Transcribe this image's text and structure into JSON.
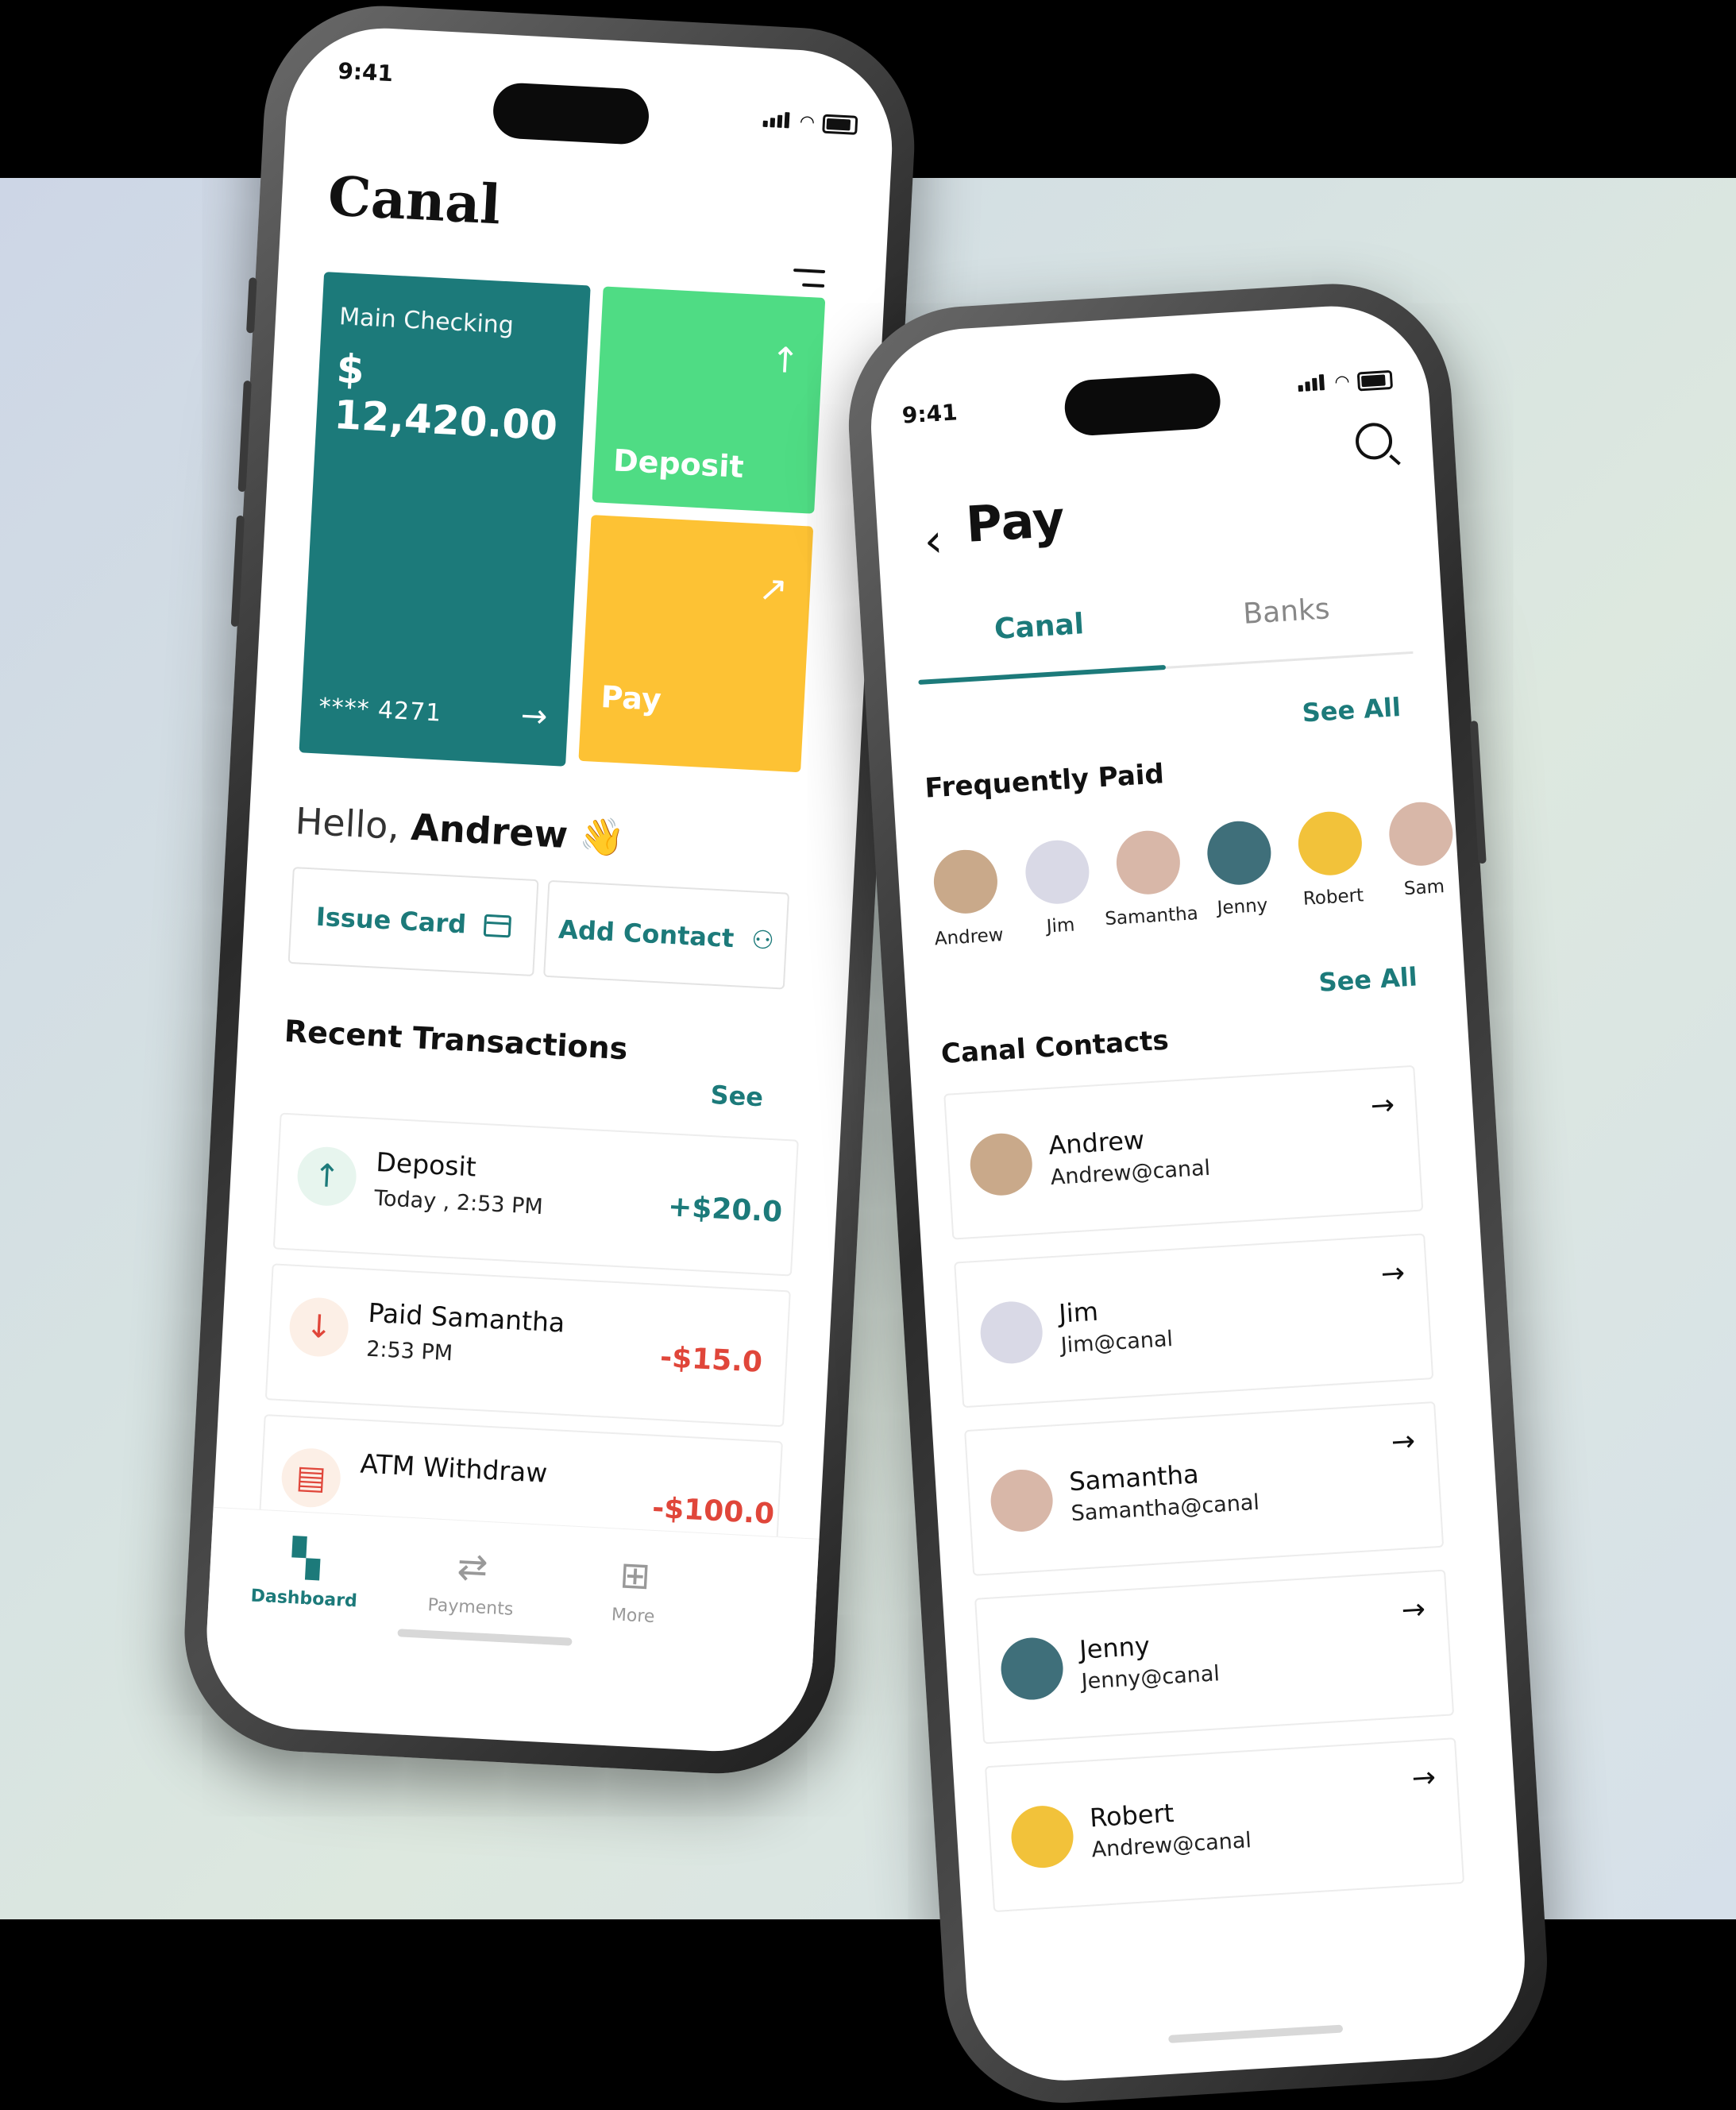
{
  "status": {
    "time": "9:41"
  },
  "dashboard": {
    "brand": "Canal",
    "account": {
      "label": "Main Checking",
      "balance": "$ 12,420.00",
      "number": "**** 4271"
    },
    "tiles": [
      {
        "label": "Deposit"
      },
      {
        "label": "Pay"
      }
    ],
    "greeting": {
      "prefix": "Hello,",
      "name": "Andrew",
      "emoji": "👋"
    },
    "quick_actions": [
      {
        "label": "Issue Card"
      },
      {
        "label": "Add Contact"
      }
    ],
    "recent": {
      "title": "Recent Transactions",
      "see_all": "See",
      "items": [
        {
          "name": "Deposit",
          "date": "Today , 2:53 PM",
          "amount": "+$20.0",
          "type": "in"
        },
        {
          "name": "Paid Samantha",
          "date": "2:53 PM",
          "amount": "-$15.0",
          "type": "out"
        },
        {
          "name": "ATM Withdraw",
          "date": "",
          "amount": "-$100.0",
          "type": "atm"
        }
      ]
    },
    "tabbar": [
      {
        "label": "Dashboard",
        "active": true
      },
      {
        "label": "Payments"
      },
      {
        "label": "More"
      }
    ]
  },
  "pay": {
    "title": "Pay",
    "tabs": [
      {
        "label": "Canal",
        "active": true
      },
      {
        "label": "Banks"
      }
    ],
    "frequent": {
      "title": "Frequently Paid",
      "see_all": "See All",
      "people": [
        {
          "name": "Andrew",
          "color": "#c9a98a"
        },
        {
          "name": "Jim",
          "color": "#d9d9e6"
        },
        {
          "name": "Samantha",
          "color": "#d8b7a8"
        },
        {
          "name": "Jenny",
          "color": "#3f6f7a"
        },
        {
          "name": "Robert",
          "color": "#f2c23a"
        },
        {
          "name": "Sam",
          "color": "#d8b7a8"
        }
      ]
    },
    "contacts": {
      "title": "Canal Contacts",
      "see_all": "See All",
      "items": [
        {
          "name": "Andrew",
          "handle": "Andrew@canal",
          "color": "#c9a98a"
        },
        {
          "name": "Jim",
          "handle": "Jim@canal",
          "color": "#d9d9e6"
        },
        {
          "name": "Samantha",
          "handle": "Samantha@canal",
          "color": "#d8b7a8"
        },
        {
          "name": "Jenny",
          "handle": "Jenny@canal",
          "color": "#3f6f7a"
        },
        {
          "name": "Robert",
          "handle": "Andrew@canal",
          "color": "#f2c23a"
        }
      ]
    }
  },
  "colors": {
    "teal": "#1c7a7a",
    "green": "#4fdc84",
    "yellow": "#fdc234",
    "red": "#e0463a"
  }
}
